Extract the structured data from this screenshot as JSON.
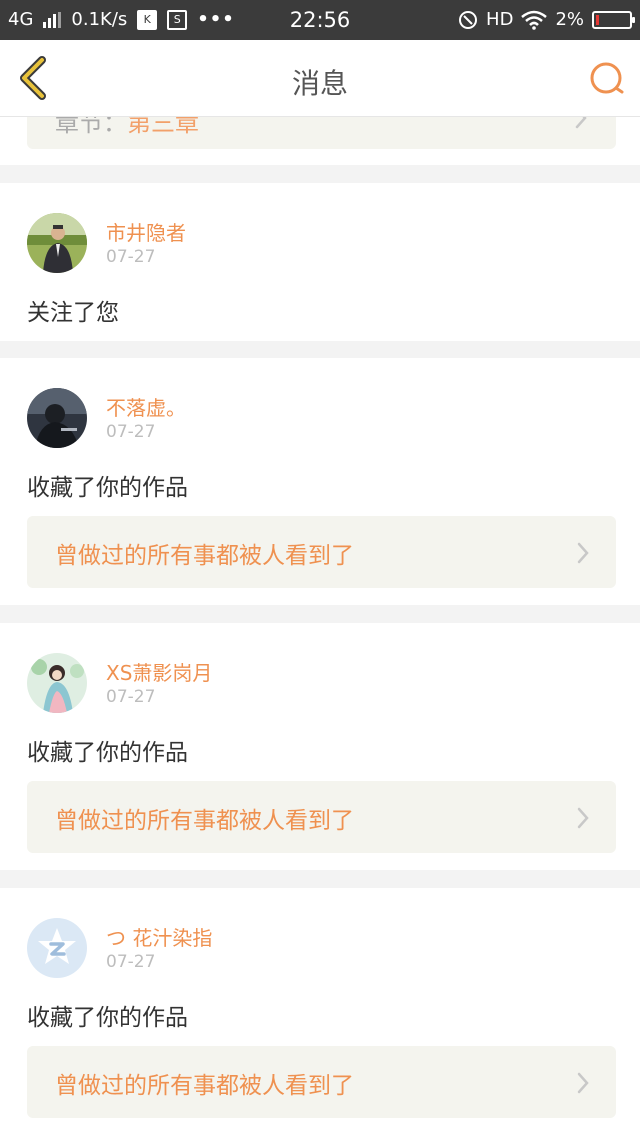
{
  "status_bar": {
    "network": "4G",
    "speed": "0.1K/s",
    "k_icon": "K",
    "s_icon": "S",
    "more": "•••",
    "time": "22:56",
    "hd": "HD",
    "battery": "2%"
  },
  "nav": {
    "title": "消息"
  },
  "partial_item": {
    "text_prefix": "章节：",
    "text_highlight": "第三章"
  },
  "messages": [
    {
      "user": "市井隐者",
      "date": "07-27",
      "action": "关注了您"
    },
    {
      "user": "不落虚。",
      "date": "07-27",
      "action": "收藏了你的作品",
      "work_title": "曾做过的所有事都被人看到了"
    },
    {
      "user": "XS萧影岗月",
      "date": "07-27",
      "action": "收藏了你的作品",
      "work_title": "曾做过的所有事都被人看到了"
    },
    {
      "user": "つ 花汁染指",
      "date": "07-27",
      "action": "收藏了你的作品",
      "work_title": "曾做过的所有事都被人看到了"
    }
  ],
  "colors": {
    "accent": "#ef9150",
    "back_icon": "#e8c23a",
    "status_bar": "#3b3b3b",
    "work_box_bg": "#f4f4ee",
    "battery_low": "#e53935"
  },
  "battery_level": 0.02
}
